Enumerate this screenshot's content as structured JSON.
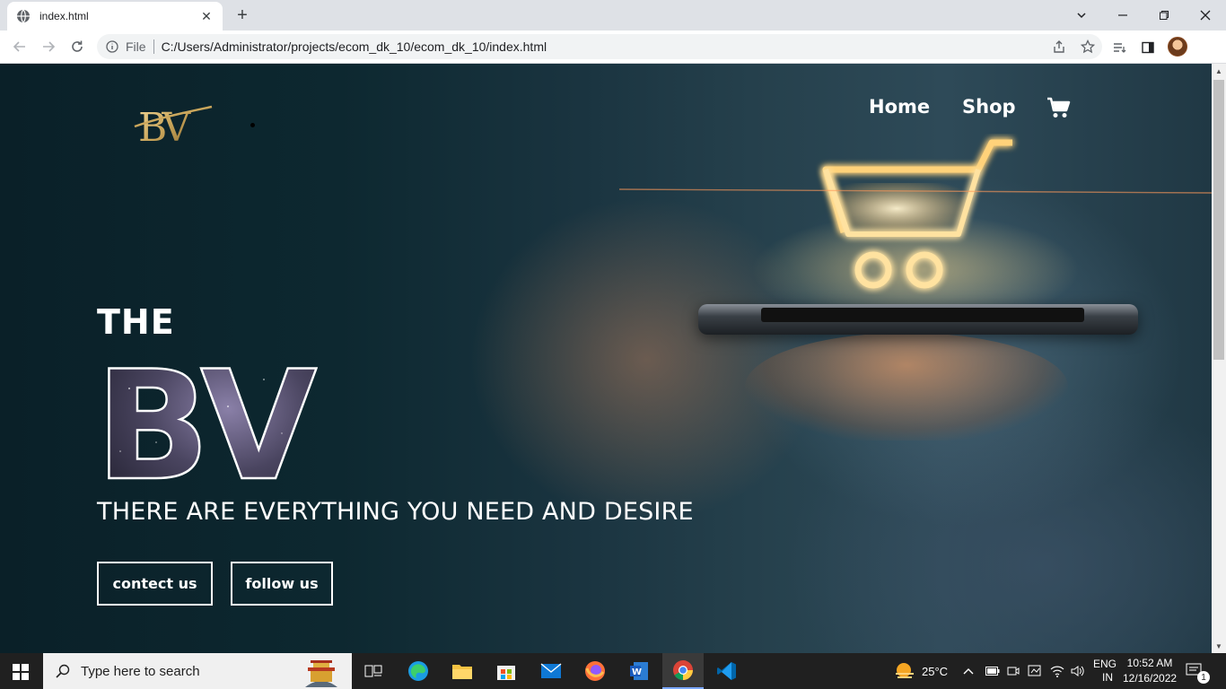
{
  "browser": {
    "tab_title": "index.html",
    "new_tab_symbol": "+",
    "address_prefix": "File",
    "url": "C:/Users/Administrator/projects/ecom_dk_10/ecom_dk_10/index.html",
    "icons": [
      "globe-icon",
      "close-icon",
      "back-icon",
      "forward-icon",
      "reload-icon",
      "info-icon",
      "share-icon",
      "bookmark-star-icon",
      "reading-list-icon",
      "side-panel-icon",
      "tab-search-icon",
      "minimize-icon",
      "restore-icon",
      "window-close-icon"
    ]
  },
  "site": {
    "logo_text": "BV",
    "nav": [
      {
        "label": "Home"
      },
      {
        "label": "Shop"
      }
    ],
    "cart_icon": "shopping-cart-icon",
    "hero": {
      "kicker": "THE",
      "brand": "BV",
      "tagline": "THERE ARE EVERYTHING YOU NEED AND DESIRE",
      "buttons": [
        {
          "label": "contect us"
        },
        {
          "label": "follow us"
        }
      ]
    },
    "colors": {
      "gold": "#c9a55a",
      "text": "#ffffff",
      "bg_dark": "#0d2830",
      "glow": "#ffd27a"
    }
  },
  "taskbar": {
    "search_placeholder": "Type here to search",
    "apps": [
      "task-view-icon",
      "edge-icon",
      "file-explorer-icon",
      "store-icon",
      "mail-icon",
      "firefox-icon",
      "word-icon",
      "chrome-icon",
      "vscode-icon"
    ],
    "weather": "25°C",
    "language_top": "ENG",
    "language_bottom": "IN",
    "time": "10:52 AM",
    "date": "12/16/2022",
    "notification_count": "1"
  }
}
